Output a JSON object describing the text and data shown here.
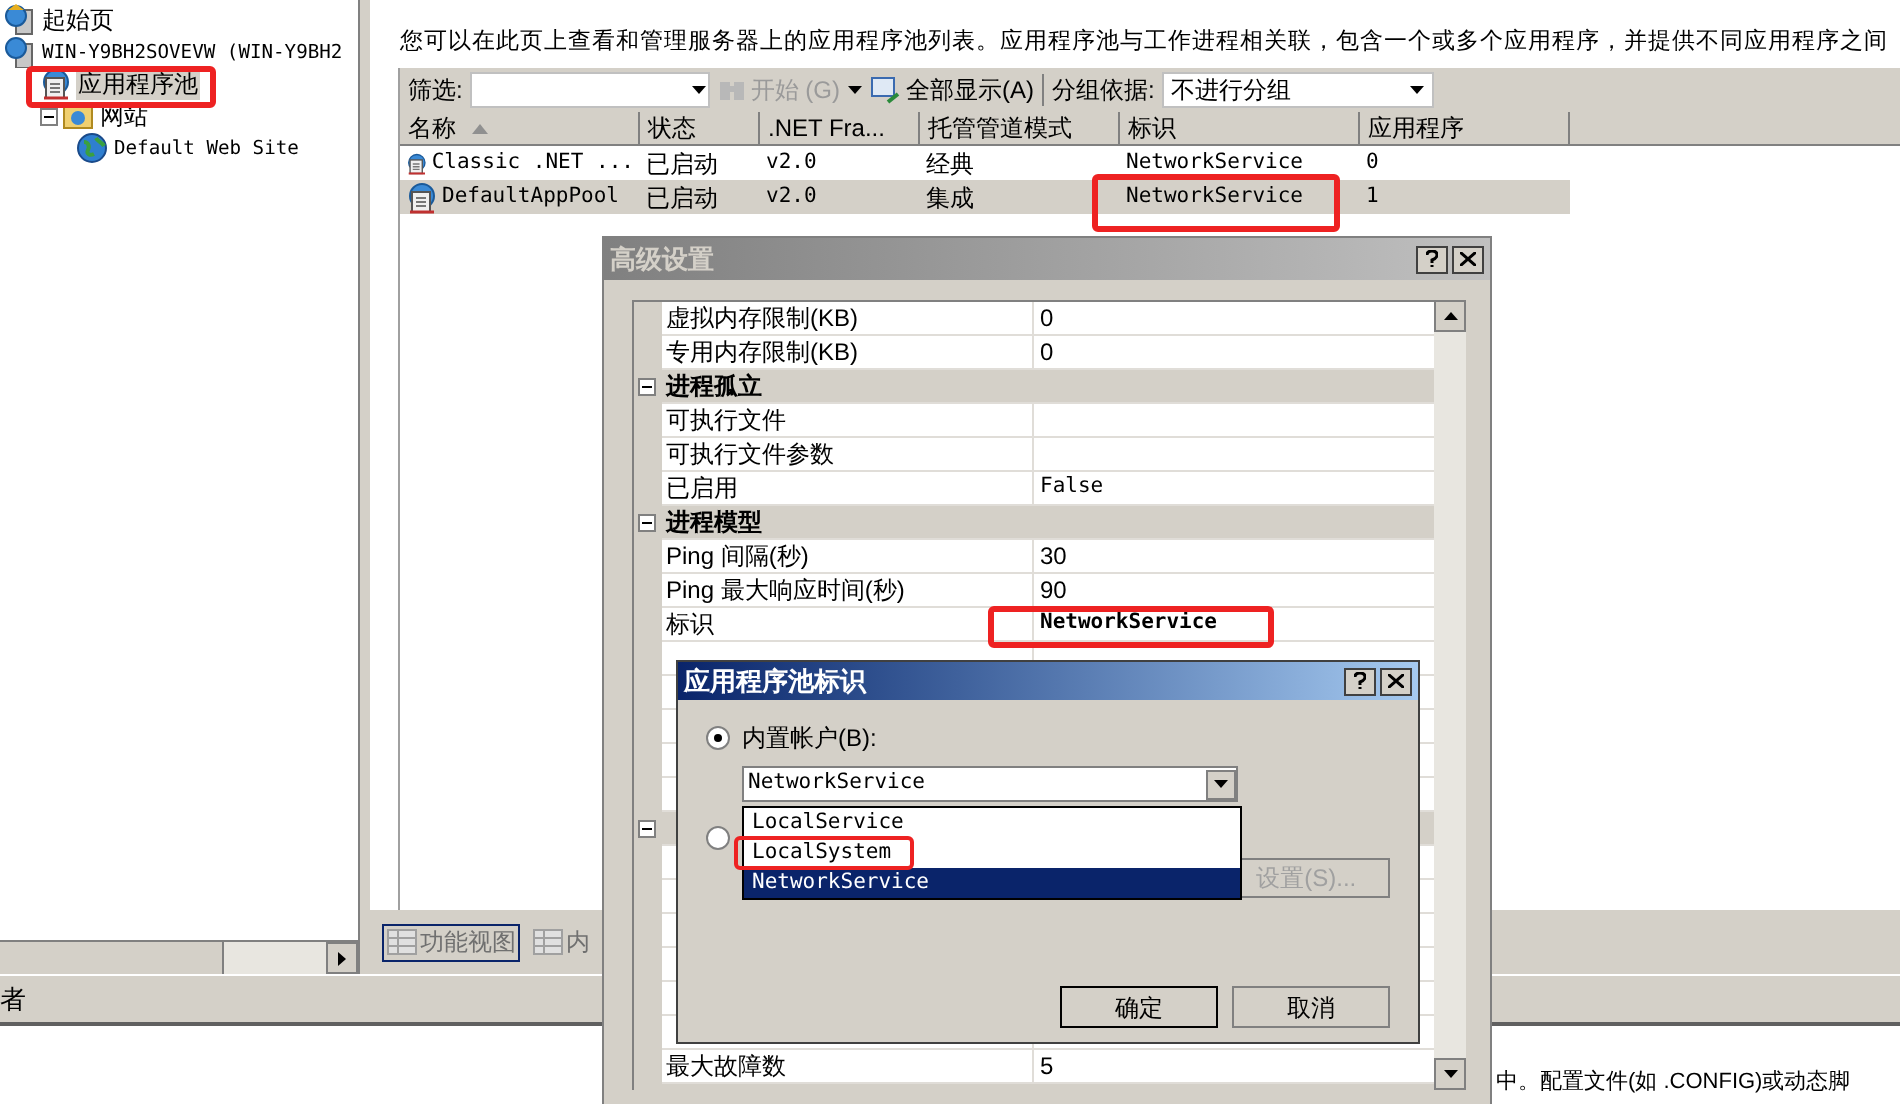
{
  "tree": [
    {
      "label": "起始页",
      "kind": "home"
    },
    {
      "label": "WIN-Y9BH2SOVEVW (WIN-Y9BH2",
      "kind": "server",
      "children": [
        {
          "label": "应用程序池",
          "kind": "pool",
          "selected": true
        },
        {
          "label": "网站",
          "kind": "folder",
          "expanded": true,
          "children": [
            {
              "label": "Default Web Site",
              "kind": "globe"
            }
          ]
        }
      ]
    }
  ],
  "description": "您可以在此页上查看和管理服务器上的应用程序池列表。应用程序池与工作进程相关联，包含一个或多个应用程序，并提供不同应用程序之间",
  "toolbar": {
    "filter_label": "筛选:",
    "start_button": {
      "label": "开始 (G)",
      "disabled": true
    },
    "show_all_button": {
      "label": "全部显示(A)",
      "disabled": false
    },
    "group_label": "分组依据:",
    "group_value": "不进行分组"
  },
  "table": {
    "columns": [
      {
        "label": "名称"
      },
      {
        "label": "状态"
      },
      {
        "label": ".NET Fra..."
      },
      {
        "label": "托管管道模式"
      },
      {
        "label": "标识"
      },
      {
        "label": "应用程序"
      }
    ],
    "rows": [
      {
        "cells": [
          "Classic .NET ...",
          "已启动",
          "v2.0",
          "经典",
          "NetworkService",
          "0"
        ],
        "selected": false
      },
      {
        "cells": [
          "DefaultAppPool",
          "已启动",
          "v2.0",
          "集成",
          "NetworkService",
          "1"
        ],
        "selected": true
      }
    ]
  },
  "view_tabs": [
    {
      "label": "功能视图",
      "selected": true
    },
    {
      "label": "内",
      "selected": false
    }
  ],
  "bottom_bar_text": "者",
  "bottom_text": "中。配置文件(如 .CONFIG)或动态脚",
  "advanced_dialog": {
    "title": "高级设置",
    "rows": [
      {
        "kind": "property",
        "label": "虚拟内存限制(KB)",
        "value": "0"
      },
      {
        "kind": "property",
        "label": "专用内存限制(KB)",
        "value": "0"
      },
      {
        "kind": "category",
        "label": "进程孤立",
        "expanded": true
      },
      {
        "kind": "property",
        "label": "可执行文件"
      },
      {
        "kind": "property",
        "label": "可执行文件参数"
      },
      {
        "kind": "property",
        "label": "已启用",
        "value": "False"
      },
      {
        "kind": "category",
        "label": "进程模型",
        "expanded": true
      },
      {
        "kind": "property",
        "label": "Ping 间隔(秒)",
        "value": "30"
      },
      {
        "kind": "property",
        "label": "Ping 最大响应时间(秒)",
        "value": "90"
      },
      {
        "kind": "property",
        "label": "标识",
        "value": "NetworkService",
        "modified": true
      },
      {
        "kind": "property"
      },
      {
        "kind": "property"
      },
      {
        "kind": "property"
      },
      {
        "kind": "property"
      },
      {
        "kind": "property"
      },
      {
        "kind": "category",
        "expanded": true
      },
      {
        "kind": "property"
      },
      {
        "kind": "property"
      },
      {
        "kind": "property"
      },
      {
        "kind": "property"
      },
      {
        "kind": "property"
      },
      {
        "kind": "property"
      },
      {
        "kind": "property",
        "label": "最大故障数",
        "value": "5"
      }
    ]
  },
  "identity_dialog": {
    "title": "应用程序池标识",
    "builtin_radio": {
      "label": "内置帐户(B):",
      "checked": true
    },
    "combo_value": "NetworkService",
    "options": [
      {
        "label": "LocalService",
        "selected": false
      },
      {
        "label": "LocalSystem",
        "selected": false
      },
      {
        "label": "NetworkService",
        "selected": true
      }
    ],
    "custom_radio": {
      "checked": false
    },
    "set_button": {
      "label": "设置(S)...",
      "disabled": true
    },
    "buttons": [
      "确定",
      "取消"
    ]
  }
}
